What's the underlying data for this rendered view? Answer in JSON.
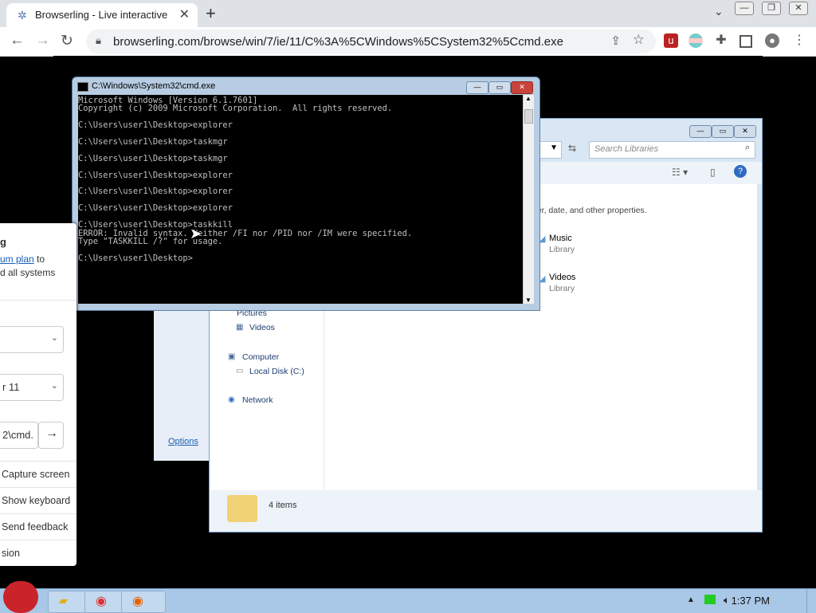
{
  "browser": {
    "tab_title": "Browserling - Live interactive cr",
    "tab_close": "✕",
    "new_tab": "+",
    "tab_dropdown": "⌄",
    "url": "browserling.com/browse/win/7/ie/11/C%3A%5CWindows%5CSystem32%5Ccmd.exe",
    "controls": {
      "minimize": "—",
      "restore": "❐",
      "close": "✕"
    }
  },
  "side_panel": {
    "heading_fragment": "g",
    "text_line1_link": "um plan",
    "text_line1_rest": " to",
    "text_line2": "d all systems",
    "os_select": "",
    "browser_select": "r 11",
    "path_input": "2\\cmd.",
    "go": "→",
    "items": [
      "Capture screen",
      "Show keyboard",
      "Send feedback",
      "sion"
    ]
  },
  "cmd": {
    "title": "C:\\Windows\\System32\\cmd.exe",
    "lines": [
      "Microsoft Windows [Version 6.1.7601]",
      "Copyright (c) 2009 Microsoft Corporation.  All rights reserved.",
      "",
      "C:\\Users\\user1\\Desktop>explorer",
      "",
      "C:\\Users\\user1\\Desktop>taskmgr",
      "",
      "C:\\Users\\user1\\Desktop>taskmgr",
      "",
      "C:\\Users\\user1\\Desktop>explorer",
      "",
      "C:\\Users\\user1\\Desktop>explorer",
      "",
      "C:\\Users\\user1\\Desktop>explorer",
      "",
      "C:\\Users\\user1\\Desktop>taskkill",
      "ERROR: Invalid syntax. Neither /FI nor /PID nor /IM were specified.",
      "Type \"TASKKILL /?\" for usage.",
      "",
      "C:\\Users\\user1\\Desktop>"
    ]
  },
  "explorer": {
    "search_placeholder": "Search Libraries",
    "hint": "der, date, and other properties.",
    "libraries": [
      {
        "name": "Music",
        "type": "Library"
      },
      {
        "name": "Videos",
        "type": "Library"
      }
    ],
    "nav": [
      "Pictures",
      "Videos",
      "Computer",
      "Local Disk (C:)",
      "Network"
    ],
    "status": "4 items",
    "options": "Options"
  },
  "taskbar": {
    "clock": "1:37 PM"
  },
  "colors": {
    "chrome_tab_bg": "#dee1e6",
    "taskbar": "#a9c7e6",
    "console_text": "#c0c0c0",
    "link": "#1a5fb4"
  }
}
